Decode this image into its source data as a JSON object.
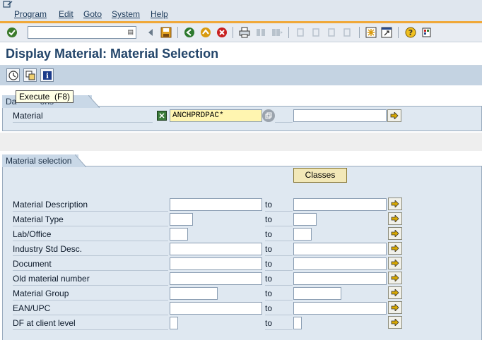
{
  "menu": [
    "Program",
    "Edit",
    "Goto",
    "System",
    "Help"
  ],
  "toolbar": {
    "command_value": ""
  },
  "title": "Display Material: Material Selection",
  "tooltip": "Execute  (F8)",
  "group1": {
    "tab": "Da          ons",
    "material_label": "Material",
    "material_value": "ANCHPRDPAC*",
    "material_to_value": ""
  },
  "group2": {
    "tab": "Material selection",
    "classes_label": "Classes",
    "to_label": "to",
    "rows": [
      {
        "label": "Material Description",
        "from": "",
        "to": ""
      },
      {
        "label": "Material Type",
        "from": "",
        "to": ""
      },
      {
        "label": "Lab/Office",
        "from": "",
        "to": ""
      },
      {
        "label": "Industry Std Desc.",
        "from": "",
        "to": ""
      },
      {
        "label": "Document",
        "from": "",
        "to": ""
      },
      {
        "label": "Old material number",
        "from": "",
        "to": ""
      },
      {
        "label": "Material Group",
        "from": "",
        "to": ""
      },
      {
        "label": "EAN/UPC",
        "from": "",
        "to": ""
      },
      {
        "label": "DF at client level",
        "from": "",
        "to": ""
      }
    ]
  },
  "colors": {
    "accent": "#f0a838",
    "title": "#23456a",
    "required_field": "#fff5b0"
  }
}
